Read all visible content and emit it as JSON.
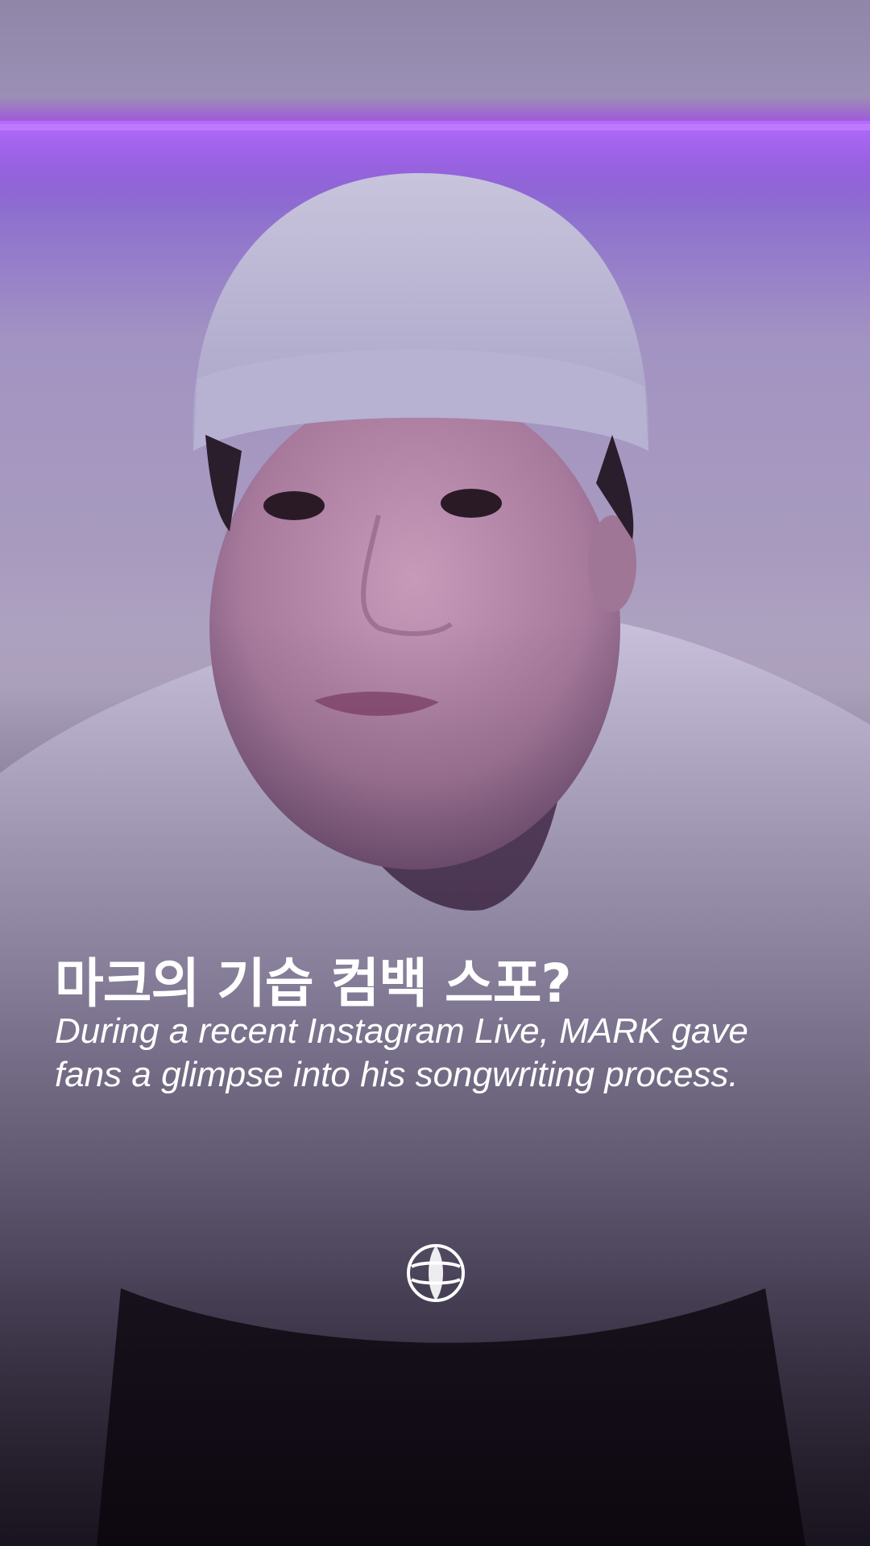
{
  "story": {
    "headline": "마크의 기습 컴백 스포?",
    "caption": "During a recent Instagram Live, MARK gave fans a glimpse into his songwriting process."
  },
  "brand": {
    "logo_icon": "globe-logo-icon"
  },
  "colors": {
    "neon_light": "#9a4cff",
    "wall": "#a99cc0",
    "text": "#ffffff"
  }
}
